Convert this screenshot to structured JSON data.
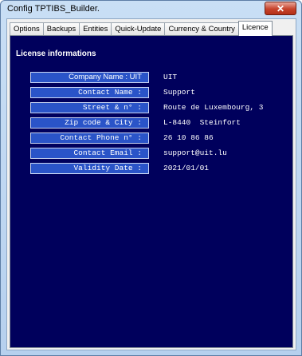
{
  "window": {
    "title": "Config TPTIBS_Builder."
  },
  "tabs": [
    {
      "label": "Options"
    },
    {
      "label": "Backups"
    },
    {
      "label": "Entities"
    },
    {
      "label": "Quick-Update"
    },
    {
      "label": "Currency & Country"
    },
    {
      "label": "Licence"
    }
  ],
  "active_tab": "Licence",
  "section_title": "License informations",
  "fields": [
    {
      "label": "Company Name : UIT",
      "value": "UIT"
    },
    {
      "label": "Contact Name :",
      "value": "Support"
    },
    {
      "label": "Street & n° :",
      "value": "Route de Luxembourg, 3"
    },
    {
      "label": "Zip code & City :",
      "value": "L-8440  Steinfort"
    },
    {
      "label": "Contact Phone n° :",
      "value": "26 10 86 86"
    },
    {
      "label": "Contact Email :",
      "value": "support@uit.lu"
    },
    {
      "label": "Validity Date :",
      "value": "2021/01/01"
    }
  ],
  "colors": {
    "panel_background": "#00005c",
    "label_background": "#2a54c8",
    "text": "#ffffff"
  }
}
